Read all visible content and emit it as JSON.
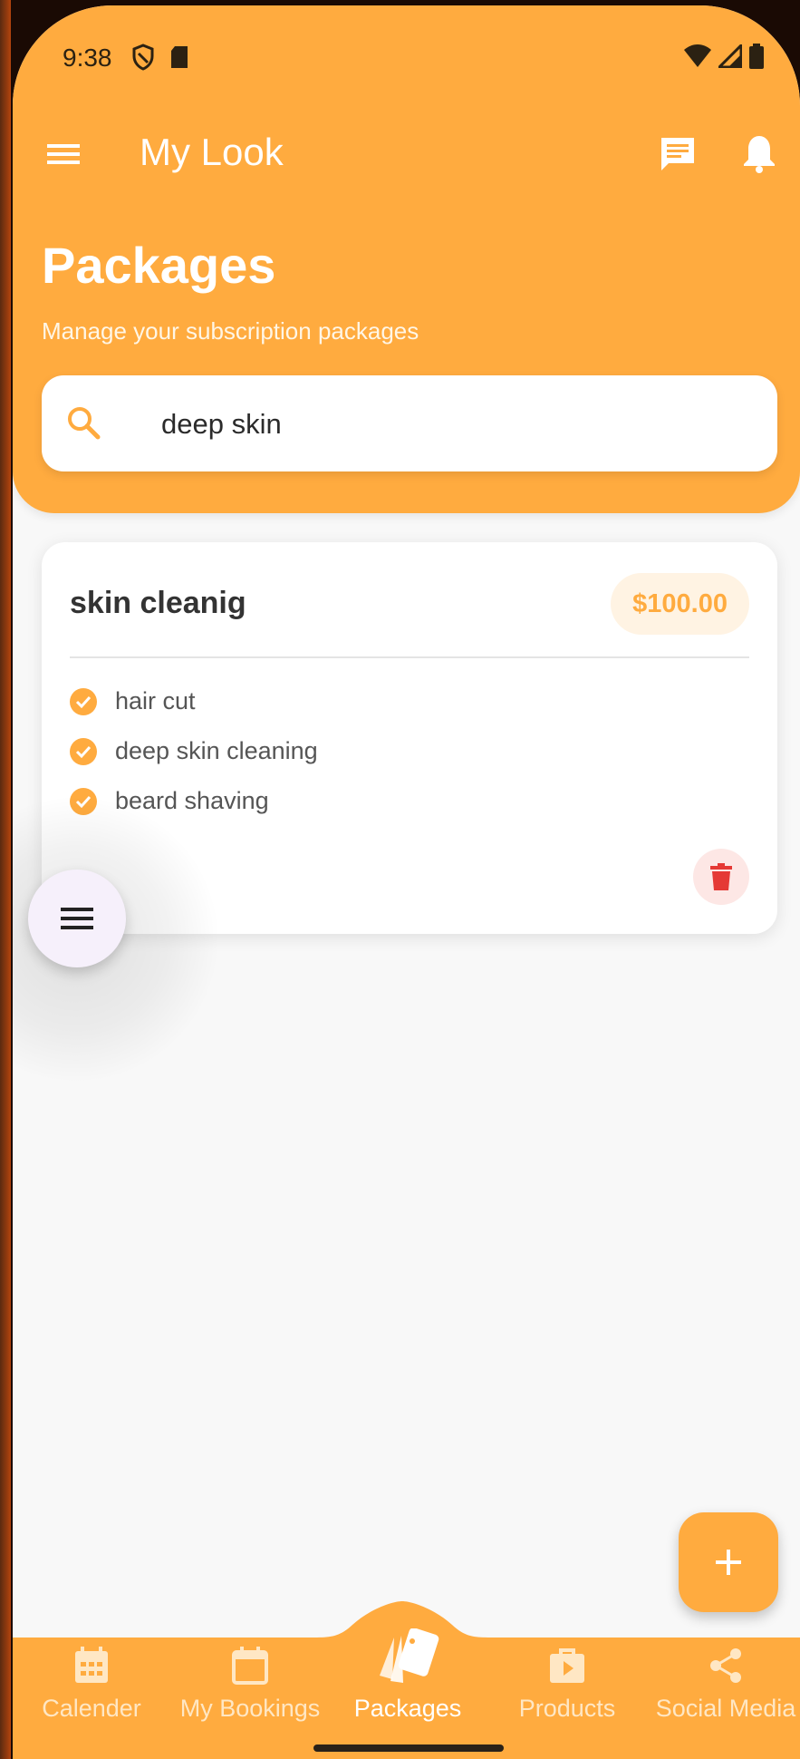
{
  "status_bar": {
    "time": "9:38"
  },
  "app_bar": {
    "title": "My Look"
  },
  "page": {
    "title": "Packages",
    "subtitle": "Manage your subscription packages"
  },
  "search": {
    "value": "deep skin"
  },
  "package_card": {
    "name": "skin cleanig",
    "price": "$100.00",
    "features": [
      "hair cut",
      "deep skin cleaning",
      "beard shaving"
    ]
  },
  "bottom_nav": {
    "items": [
      {
        "label": "Calender",
        "icon": "calendar-grid-icon"
      },
      {
        "label": "My Bookings",
        "icon": "calendar-icon"
      },
      {
        "label": "Packages",
        "icon": "cards-icon",
        "active": true
      },
      {
        "label": "Products",
        "icon": "shopping-bag-play-icon"
      },
      {
        "label": "Social Media",
        "icon": "share-icon"
      }
    ]
  },
  "colors": {
    "primary": "#ffab3f",
    "delete": "#e53935",
    "background": "#f8f8f8"
  }
}
